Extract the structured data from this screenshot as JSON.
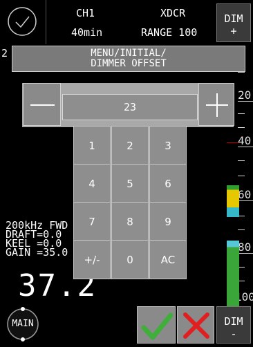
{
  "header": {
    "channel": "CH1",
    "duration": "40min",
    "transducer": "XDCR",
    "range": "RANGE 100",
    "dim_plus": {
      "line1": "DIM",
      "line2": "+"
    }
  },
  "menu": {
    "left_fragment": "2",
    "title_line1": "MENU/INITIAL/",
    "title_line2": "DIMMER OFFSET"
  },
  "stepper": {
    "value": "23"
  },
  "keypad": {
    "keys": [
      "1",
      "2",
      "3",
      "4",
      "5",
      "6",
      "7",
      "8",
      "9",
      "+/-",
      "0",
      "AC"
    ]
  },
  "status": {
    "freq": "200kHz FWD",
    "draft": "DRAFT=0.0",
    "keel": "KEEL =0.0",
    "gain": "GAIN =35.0",
    "depth": "37.2"
  },
  "scale": {
    "labels": [
      "20",
      "40",
      "60",
      "80",
      "100"
    ]
  },
  "footer": {
    "main_label": "MAIN",
    "dim_minus": {
      "line1": "DIM",
      "line2": "-"
    }
  },
  "colors": {
    "accept": "#3fae3a",
    "cancel": "#e02020",
    "button_gray": "#8a8a8a"
  }
}
